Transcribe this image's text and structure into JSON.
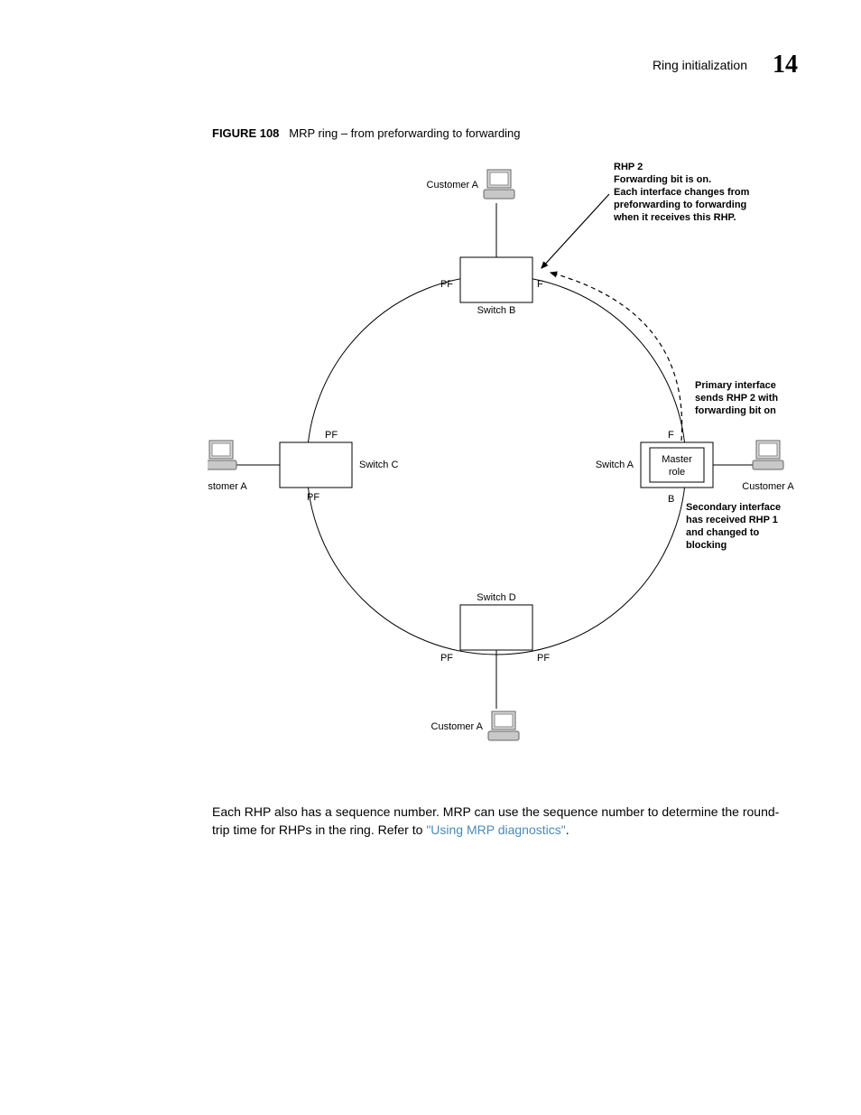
{
  "header": {
    "section": "Ring initialization",
    "chapter_num": "14"
  },
  "figure": {
    "label": "FIGURE 108",
    "caption": "MRP ring – from preforwarding to forwarding"
  },
  "diagram": {
    "customers": {
      "top": "Customer A",
      "left": "Customer A",
      "right": "Customer A",
      "bottom": "Customer A"
    },
    "switches": {
      "b": "Switch B",
      "c": "Switch C",
      "d": "Switch D",
      "a": "Switch A"
    },
    "master_role": "Master\nrole",
    "ports": {
      "b_left": "PF",
      "b_right": "F",
      "c_top": "PF",
      "c_bottom": "PF",
      "d_left": "PF",
      "d_right": "PF",
      "a_top": "F",
      "a_bottom": "B"
    },
    "annotations": {
      "rhp2_title": "RHP 2",
      "rhp2_l1": "Forwarding bit is on.",
      "rhp2_l2": "Each interface changes from",
      "rhp2_l3": "preforwarding to forwarding",
      "rhp2_l4": "when it receives this RHP.",
      "primary_l1": "Primary interface",
      "primary_l2": "sends RHP 2 with",
      "primary_l3": "forwarding bit on",
      "secondary_l1": "Secondary interface",
      "secondary_l2": "has received RHP 1",
      "secondary_l3": "and changed to",
      "secondary_l4": "blocking"
    }
  },
  "body": {
    "text1": "Each RHP also has a sequence number. MRP can use the sequence number to determine the round-trip time for RHPs in the ring. Refer to ",
    "link": "\"Using MRP diagnostics\"",
    "text2": "."
  }
}
